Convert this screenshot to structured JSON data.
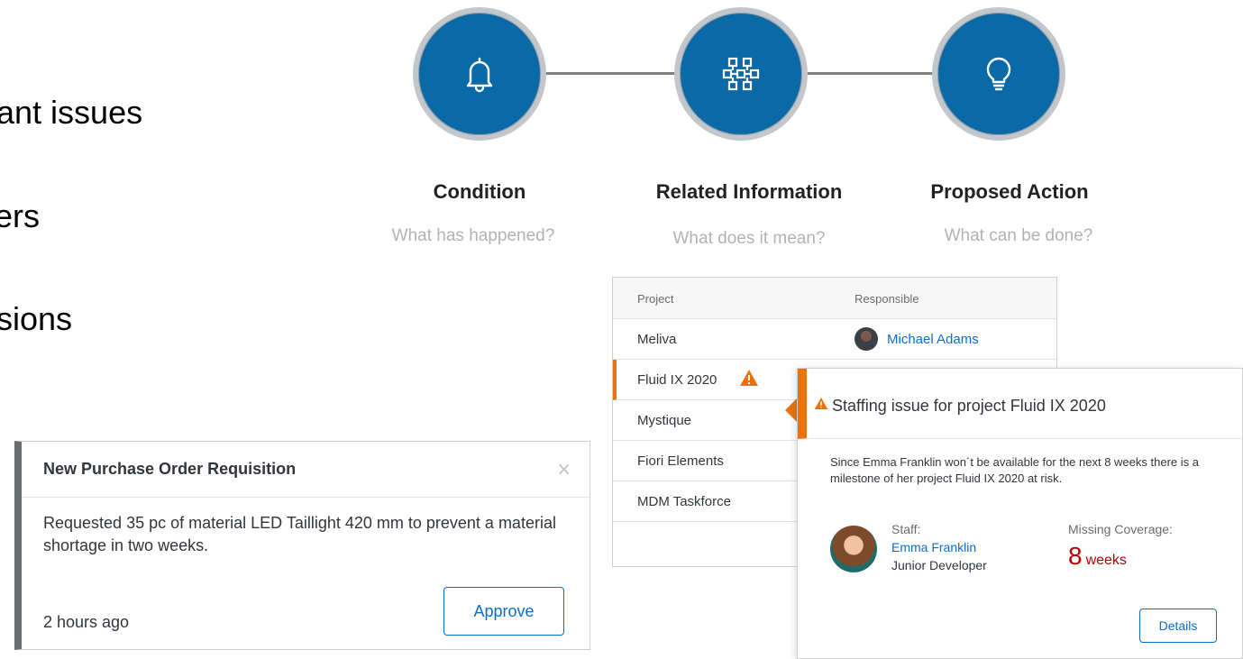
{
  "bullets": [
    "ant issues",
    "ers",
    "sions"
  ],
  "flow": {
    "steps": [
      {
        "icon": "bell-icon",
        "title": "Condition",
        "subtitle": "What has happened?"
      },
      {
        "icon": "network-icon",
        "title": "Related Information",
        "subtitle": "What does it mean?"
      },
      {
        "icon": "lightbulb-icon",
        "title": "Proposed Action",
        "subtitle": "What can be done?"
      }
    ],
    "circle_color": "#0a6aa8"
  },
  "notification": {
    "title": "New Purchase Order Requisition",
    "close_symbol": "×",
    "body": "Requested 35 pc of material LED Taillight 420 mm to prevent a material shortage in two weeks.",
    "time": "2 hours ago",
    "approve_label": "Approve"
  },
  "project_table": {
    "headers": [
      "Project",
      "Responsible"
    ],
    "rows": [
      {
        "project": "Meliva",
        "responsible": "Michael Adams"
      },
      {
        "project": "Fluid IX 2020",
        "responsible": "",
        "warning": true,
        "selected": true
      },
      {
        "project": "Mystique",
        "responsible": ""
      },
      {
        "project": "Fiori Elements",
        "responsible": ""
      },
      {
        "project": "MDM Taskforce",
        "responsible": ""
      }
    ]
  },
  "popover": {
    "title": "Staffing issue for project Fluid IX 2020",
    "description": "Since Emma Franklin won´t be available for the next 8 weeks there is a milestone of her project Fluid IX 2020 at risk.",
    "staff_label": "Staff:",
    "staff_name": "Emma Franklin",
    "staff_role": "Junior Developer",
    "missing_label": "Missing Coverage:",
    "missing_value": "8",
    "missing_unit": "weeks",
    "details_label": "Details",
    "warning_color": "#e9730c",
    "critical_color": "#bb0000"
  }
}
